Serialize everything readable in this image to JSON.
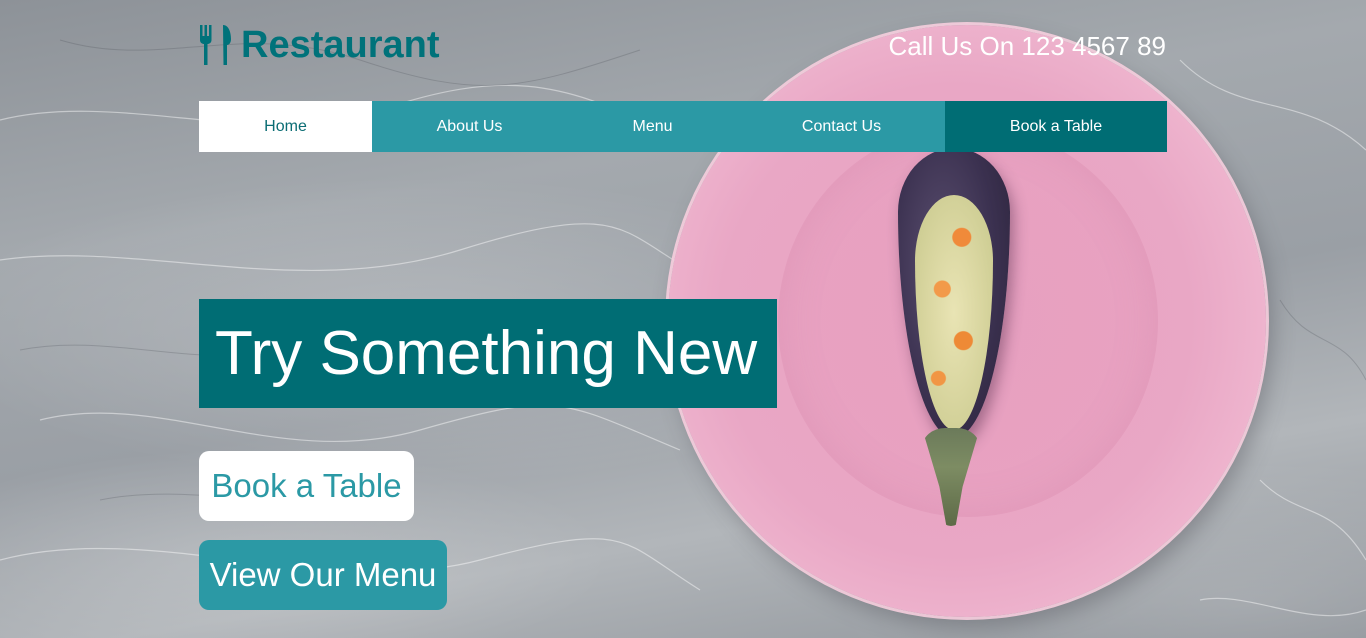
{
  "brand": {
    "name": "Restaurant",
    "icon": "utensils-icon",
    "color": "#00727a"
  },
  "header": {
    "phone_text": "Call Us On 123 4567 89"
  },
  "nav": {
    "items": [
      {
        "label": "Home",
        "active": true
      },
      {
        "label": "About Us"
      },
      {
        "label": "Menu"
      },
      {
        "label": "Contact Us"
      },
      {
        "label": "Book a Table",
        "highlight": true
      }
    ],
    "colors": {
      "bar": "#2b99a5",
      "highlight": "#006d74",
      "active_bg": "#ffffff"
    }
  },
  "hero": {
    "headline": "Try Something New",
    "buttons": {
      "book": "Book a Table",
      "menu": "View Our Menu"
    }
  },
  "colors": {
    "teal_dark": "#006d74",
    "teal": "#2b99a5",
    "plate_pink": "#e9a7c5"
  }
}
